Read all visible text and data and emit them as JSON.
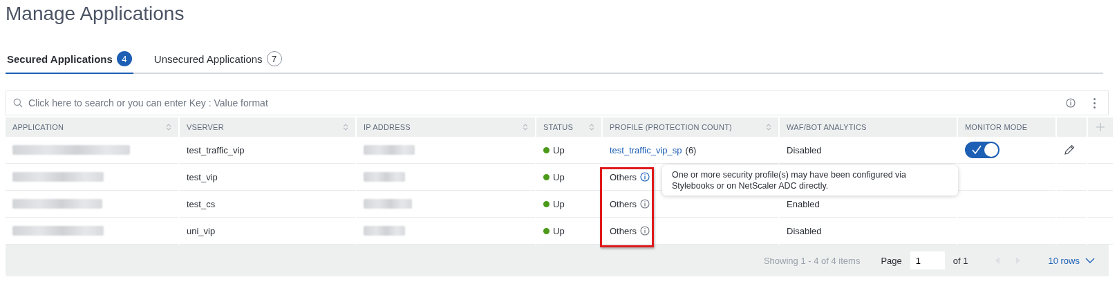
{
  "page_title": "Manage Applications",
  "tabs": [
    {
      "label": "Secured Applications",
      "count": "4",
      "selected": true
    },
    {
      "label": "Unsecured Applications",
      "count": "7",
      "selected": false
    }
  ],
  "search": {
    "placeholder": "Click here to search or you can enter Key : Value format"
  },
  "table": {
    "columns": [
      {
        "label": "APPLICATION",
        "sortable": true
      },
      {
        "label": "VSERVER",
        "sortable": true
      },
      {
        "label": "IP ADDRESS",
        "sortable": true
      },
      {
        "label": "STATUS",
        "sortable": true
      },
      {
        "label": "PROFILE (PROTECTION COUNT)",
        "sortable": true
      },
      {
        "label": "WAF/BOT ANALYTICS",
        "sortable": false
      },
      {
        "label": "MONITOR MODE",
        "sortable": false
      }
    ],
    "rows": [
      {
        "application": {
          "kind": "redacted"
        },
        "vserver": "test_traffic_vip",
        "ip_address": {
          "kind": "redacted"
        },
        "status": {
          "label": "Up",
          "color": "#4c9a1a"
        },
        "profile": {
          "kind": "link",
          "name": "test_traffic_vip_sp",
          "count": "(6)"
        },
        "waf_bot_analytics": "Disabled",
        "monitor_mode": {
          "on": true
        },
        "editable": true
      },
      {
        "application": {
          "kind": "redacted"
        },
        "vserver": "test_vip",
        "ip_address": {
          "kind": "redacted"
        },
        "status": {
          "label": "Up",
          "color": "#4c9a1a"
        },
        "profile": {
          "kind": "others",
          "name": "Others",
          "info_active": true
        },
        "editable": false
      },
      {
        "application": {
          "kind": "redacted"
        },
        "vserver": "test_cs",
        "ip_address": {
          "kind": "redacted"
        },
        "status": {
          "label": "Up",
          "color": "#4c9a1a"
        },
        "profile": {
          "kind": "others",
          "name": "Others",
          "info_active": false
        },
        "waf_bot_analytics": "Enabled",
        "editable": false
      },
      {
        "application": {
          "kind": "redacted"
        },
        "vserver": "uni_vip",
        "ip_address": {
          "kind": "redacted"
        },
        "status": {
          "label": "Up",
          "color": "#4c9a1a"
        },
        "profile": {
          "kind": "others",
          "name": "Others",
          "info_active": false
        },
        "waf_bot_analytics": "Disabled",
        "editable": false
      }
    ]
  },
  "tooltip": {
    "text": "One or more security profile(s) may have been configured via Stylebooks or on NetScaler ADC directly."
  },
  "annotation": {
    "kind": "highlight_box"
  },
  "pagination": {
    "summary": "Showing 1 - 4 of 4 items",
    "page_label": "Page",
    "page_value": "1",
    "of_pages": "of 1",
    "rows_per_page": "10 rows"
  }
}
